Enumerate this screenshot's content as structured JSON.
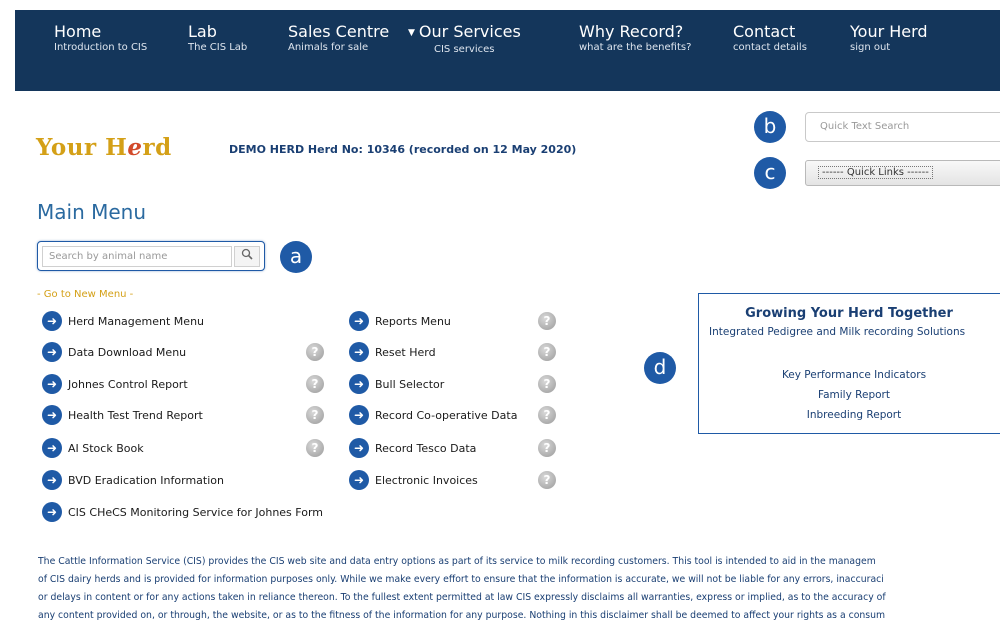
{
  "nav": [
    {
      "title": "Home",
      "subtitle": "Introduction to CIS"
    },
    {
      "title": "Lab",
      "subtitle": "The CIS Lab"
    },
    {
      "title": "Sales Centre",
      "subtitle": "Animals for sale"
    },
    {
      "title": "Our Services",
      "subtitle": "CIS services",
      "arrow": "▼"
    },
    {
      "title": "Why Record?",
      "subtitle": "what are the benefits?"
    },
    {
      "title": "Contact",
      "subtitle": "contact details"
    },
    {
      "title": "Your Herd",
      "subtitle": "sign out"
    }
  ],
  "logo": {
    "part1": "Your H",
    "part2": "e",
    "part3": "rd"
  },
  "herd_info": "DEMO HERD Herd No: 10346 (recorded on 12 May 2020)",
  "badges": {
    "a": "a",
    "b": "b",
    "c": "c",
    "d": "d"
  },
  "quick_search": {
    "placeholder": "Quick Text Search"
  },
  "quick_links": {
    "selected": "------ Quick Links ------"
  },
  "main_menu": {
    "title": "Main Menu"
  },
  "animal_search": {
    "placeholder": "Search by animal name",
    "icon": "search-icon"
  },
  "new_menu_link": "- Go to New Menu -",
  "menu_left": [
    {
      "label": "Herd Management Menu",
      "help": false
    },
    {
      "label": "Data Download Menu",
      "help": true
    },
    {
      "label": "Johnes Control Report",
      "help": true
    },
    {
      "label": "Health Test Trend Report",
      "help": true
    },
    {
      "label": "AI Stock Book",
      "help": true
    },
    {
      "label": "BVD Eradication Information",
      "help": false
    },
    {
      "label": "CIS CHeCS Monitoring Service for Johnes Form",
      "help": false
    }
  ],
  "menu_right": [
    {
      "label": "Reports Menu",
      "help": true
    },
    {
      "label": "Reset Herd",
      "help": true
    },
    {
      "label": "Bull Selector",
      "help": true
    },
    {
      "label": "Record Co-operative Data",
      "help": true
    },
    {
      "label": "Record Tesco Data",
      "help": true
    },
    {
      "label": "Electronic Invoices",
      "help": true
    }
  ],
  "help_glyph": "?",
  "arrow_glyph": "➜",
  "grow_box": {
    "title": "Growing Your Herd Together",
    "subtitle": "Integrated Pedigree and Milk recording Solutions",
    "links": [
      "Key Performance Indicators",
      "Family Report",
      "Inbreeding Report"
    ]
  },
  "disclaimer": [
    "The Cattle Information Service (CIS) provides the CIS web site and data entry options as part of its service to milk recording customers. This tool is intended to aid in the managem",
    "of CIS dairy herds and is provided for information purposes only. While we make every effort to ensure that the information is accurate, we will not be liable for any errors, inaccuraci",
    "or delays in content or for any actions taken in reliance thereon. To the fullest extent permitted at law CIS expressly disclaims all warranties, express or implied, as to the accuracy of",
    "any content provided on, or through, the website, or as to the fitness of the information for any purpose. Nothing in this disclaimer shall be deemed to affect your rights as a consum"
  ],
  "colors": {
    "navy": "#14365b",
    "accent": "#1f5aa6",
    "gold": "#d4a017"
  }
}
